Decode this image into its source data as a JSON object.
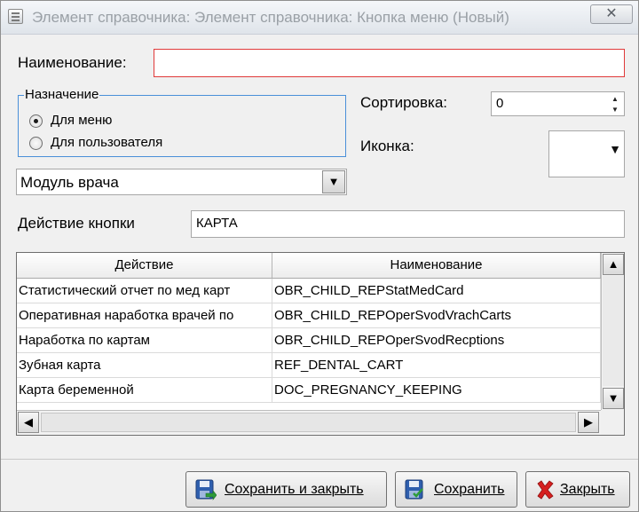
{
  "window": {
    "title": "Элемент справочника: Элемент справочника: Кнопка меню (Новый)",
    "close_glyph": "✕"
  },
  "form": {
    "name_label": "Наименование:",
    "name_value": "",
    "purpose": {
      "legend": "Назначение",
      "options": [
        {
          "label": "Для меню",
          "checked": true
        },
        {
          "label": "Для пользователя",
          "checked": false
        }
      ]
    },
    "sort_label": "Сортировка:",
    "sort_value": "0",
    "icon_label": "Иконка:",
    "module_value": "Модуль врача",
    "action_label": "Действие кнопки",
    "action_value": "КАРТА"
  },
  "grid": {
    "columns": [
      "Действие",
      "Наименование"
    ],
    "rows": [
      [
        "Статистический отчет по мед карт",
        "OBR_CHILD_REPStatMedCard"
      ],
      [
        "Оперативная наработка врачей по",
        "OBR_CHILD_REPOperSvodVrachCarts"
      ],
      [
        "Наработка по картам",
        "OBR_CHILD_REPOperSvodRecptions"
      ],
      [
        "Зубная карта",
        "REF_DENTAL_CART"
      ],
      [
        "Карта беременной",
        "DOC_PREGNANCY_KEEPING"
      ]
    ]
  },
  "buttons": {
    "save_close": "Сохранить и закрыть",
    "save": "Сохранить",
    "close": "Закрыть"
  },
  "colors": {
    "error_border": "#e03a3a",
    "group_border": "#4a90d9",
    "close_icon_red": "#d62020"
  }
}
